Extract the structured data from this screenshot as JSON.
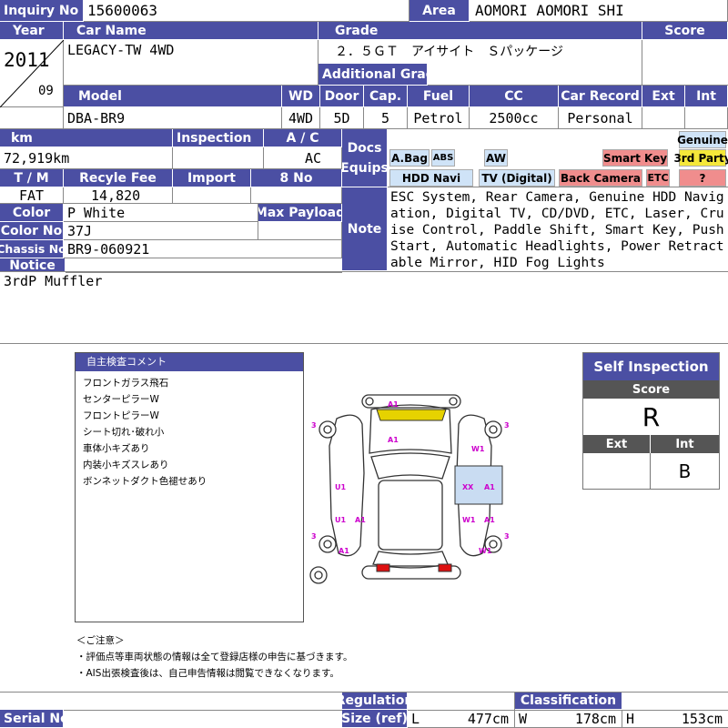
{
  "labels": {
    "inquiry_no": "Inquiry No",
    "area": "Area",
    "year": "Year",
    "car_name": "Car Name",
    "grade": "Grade",
    "score": "Score",
    "additional_grade": "Additional Grade",
    "model": "Model",
    "wd": "WD",
    "door": "Door",
    "cap": "Cap.",
    "fuel": "Fuel",
    "cc": "CC",
    "car_record": "Car Record",
    "ext": "Ext",
    "int": "Int",
    "km": "km",
    "inspection": "Inspection",
    "ac": "A / C",
    "docs_equips_1": "Docs",
    "docs_equips_2": "Equips",
    "tm": "T / M",
    "recycle_fee": "Recyle Fee",
    "import": "Import",
    "eight_no": "8 No",
    "color": "Color",
    "max_payload": "Max Payload",
    "color_no": "Color No",
    "note": "Note",
    "chassis_no": "Chassis No",
    "notice": "Notice",
    "serial_no": "Serial No",
    "regulation": "Regulation",
    "size_ref": "Size (ref)",
    "classification": "Classification",
    "size_l": "L",
    "size_w": "W",
    "size_h": "H"
  },
  "values": {
    "inquiry_no": "15600063",
    "area": "AOMORI AOMORI SHI",
    "year": "2011",
    "month": "09",
    "car_name": "LEGACY-TW 4WD",
    "grade": "２．５ＧＴ　アイサイト　Ｓパッケージ",
    "model": "DBA-BR9",
    "wd": "4WD",
    "door": "5D",
    "cap": "5",
    "fuel": "Petrol",
    "cc": "2500cc",
    "car_record": "Personal",
    "km": "72,919km",
    "ac": "AC",
    "tm": "FAT",
    "recycle_fee": "14,820",
    "color": "P White",
    "color_no": "37J",
    "chassis_no": "BR9-060921",
    "note": "ESC System, Rear Camera, Genuine HDD Navigation, Digital TV, CD/DVD, ETC, Laser, Cruise Control, Paddle Shift, Smart Key, Push Start, Automatic Headlights, Power Retractable Mirror, HID Fog Lights",
    "notice": "3rdP Muffler",
    "size_l": "477cm",
    "size_w": "178cm",
    "size_h": "153cm"
  },
  "equips": {
    "abag": "A.Bag",
    "abs": "ABS",
    "aw": "AW",
    "smart_key": "Smart Key",
    "hdd_navi": "HDD Navi",
    "tv": "TV (Digital)",
    "back_camera": "Back Camera",
    "etc": "ETC",
    "genuine": "Genuine",
    "third_party": "3rd Party",
    "question": "?"
  },
  "inspection_comments": {
    "title": "自主検査コメント",
    "items": [
      "フロントガラス飛石",
      "センターピラーW",
      "フロントピラーW",
      "シート切れ･破れ小",
      "車体小キズあり",
      "内装小キズスレあり",
      "ボンネットダクト色褪せあり"
    ]
  },
  "self_inspection": {
    "title": "Self Inspection",
    "score_label": "Score",
    "score": "R",
    "ext_label": "Ext",
    "int_label": "Int",
    "ext": "",
    "int": "B"
  },
  "cautions": [
    "＜ご注意＞",
    "・評価点等車両状態の情報は全て登録店様の申告に基づきます。",
    "・AIS出張検査後は、自己申告情報は閲覧できなくなります。"
  ],
  "damage_marks": [
    "A1",
    "A1",
    "3",
    "W1",
    "3",
    "U1",
    "XX",
    "A1",
    "U1",
    "A1",
    "W1",
    "A1",
    "3",
    "A1",
    "3",
    "W1"
  ],
  "colors": {
    "header": "#4b4fa3",
    "mark": "#cc00cc",
    "windshield": "#e6d200",
    "tail": "#dd1111",
    "panel": "#c9dcf2"
  }
}
